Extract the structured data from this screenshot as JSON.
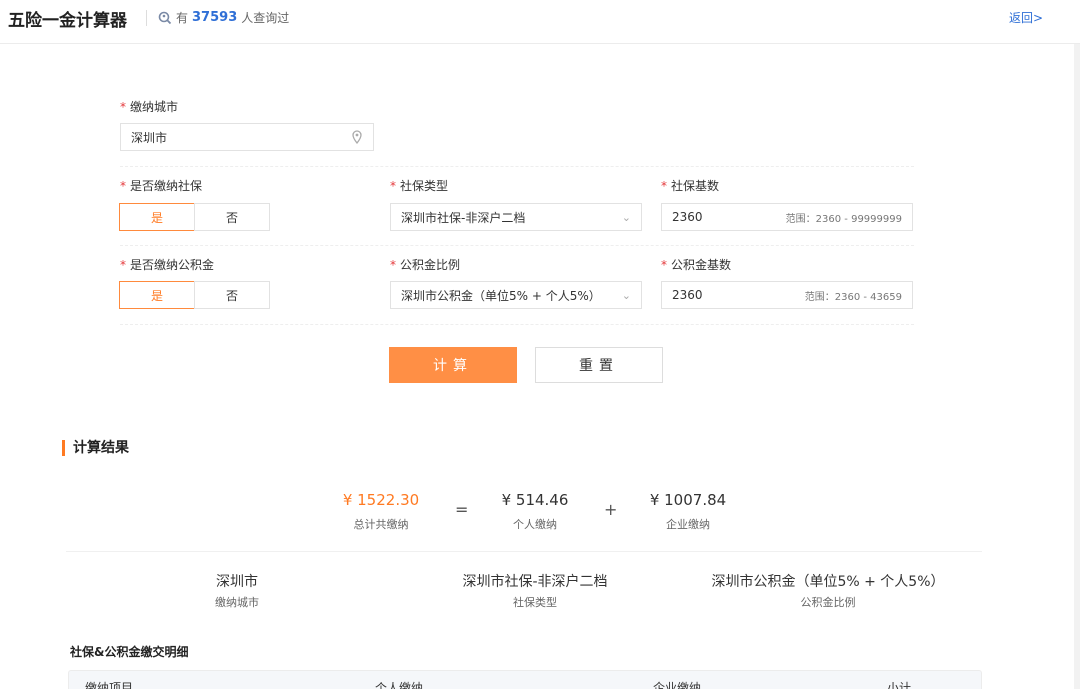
{
  "header": {
    "title": "五险一金计算器",
    "stats_prefix": "有",
    "stats_count": "37593",
    "stats_suffix": "人查询过",
    "back_label": "返回>"
  },
  "form": {
    "city": {
      "label": "缴纳城市",
      "value": "深圳市"
    },
    "social": {
      "label": "是否缴纳社保",
      "options": [
        "是",
        "否"
      ],
      "selected": "是"
    },
    "social_type": {
      "label": "社保类型",
      "value": "深圳市社保-非深户二档"
    },
    "social_base": {
      "label": "社保基数",
      "value": "2360",
      "range": "范围：2360 - 99999999"
    },
    "fund": {
      "label": "是否缴纳公积金",
      "options": [
        "是",
        "否"
      ],
      "selected": "是"
    },
    "fund_ratio": {
      "label": "公积金比例",
      "value": "深圳市公积金（单位5% + 个人5%）"
    },
    "fund_base": {
      "label": "公积金基数",
      "value": "2360",
      "range": "范围：2360 - 43659"
    },
    "calc_label": "计算",
    "reset_label": "重置"
  },
  "result": {
    "title": "计算结果",
    "total_value": "¥ 1522.30",
    "total_label": "总计共缴纳",
    "eq": "=",
    "personal_value": "¥ 514.46",
    "personal_label": "个人缴纳",
    "plus": "+",
    "company_value": "¥ 1007.84",
    "company_label": "企业缴纳",
    "info": [
      {
        "value": "深圳市",
        "label": "缴纳城市"
      },
      {
        "value": "深圳市社保-非深户二档",
        "label": "社保类型"
      },
      {
        "value": "深圳市公积金（单位5% + 个人5%）",
        "label": "公积金比例"
      }
    ],
    "detail_title": "社保&公积金缴交明细",
    "columns": [
      "缴纳项目",
      "个人缴纳",
      "企业缴纳",
      "小计"
    ]
  },
  "colors": {
    "accent": "#ff7a22",
    "button": "#ff8f45",
    "link": "#2f6fd6",
    "required": "#e4393c"
  }
}
